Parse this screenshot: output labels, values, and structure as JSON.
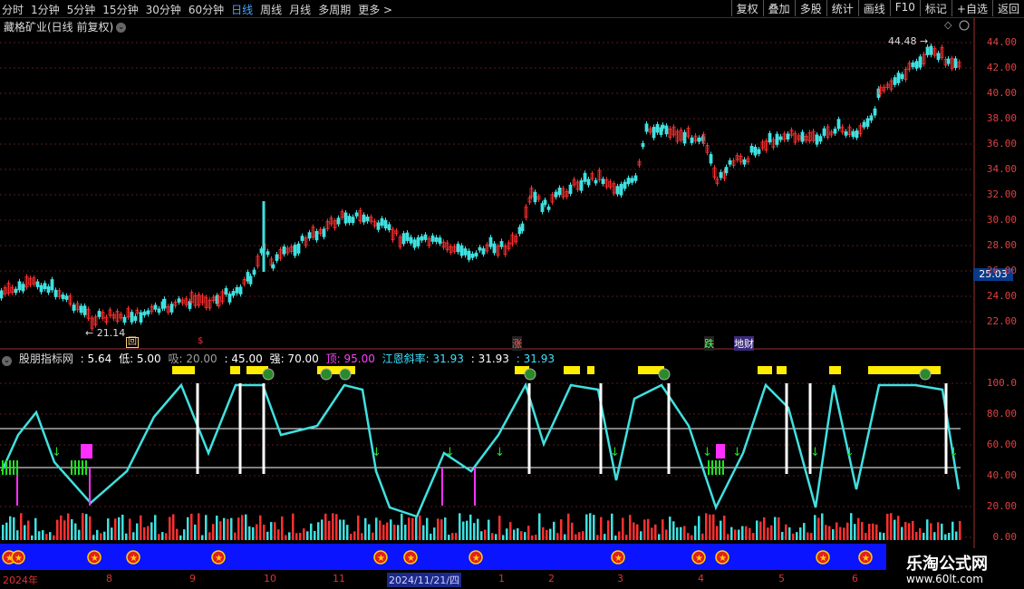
{
  "toolbar": {
    "periods": [
      "分时",
      "1分钟",
      "5分钟",
      "15分钟",
      "30分钟",
      "60分钟",
      "日线",
      "周线",
      "月线",
      "多周期",
      "更多 >"
    ],
    "active_period": "日线",
    "actions": [
      "复权",
      "叠加",
      "多股",
      "统计",
      "画线",
      "F10",
      "标记",
      "+自选",
      "返回"
    ]
  },
  "stock": {
    "title": "藏格矿业(日线 前复权)"
  },
  "price_axis": [
    "44.00",
    "42.00",
    "40.00",
    "38.00",
    "36.00",
    "34.00",
    "32.00",
    "30.00",
    "28.00",
    "26.00",
    "24.00",
    "22.00"
  ],
  "current_price": "25.03",
  "annotations": {
    "high": "44.48",
    "low": "21.14"
  },
  "markers": [
    "回",
    "$",
    "涨",
    "跌",
    "地财"
  ],
  "indicator": {
    "name": "股朋指标网",
    "v1": ": 5.64",
    "low_label": "低: 5.00",
    "xi_label": "吸: 20.00",
    "v2": ": 45.00",
    "qiang_label": "强: 70.00",
    "ding_label": "顶: 95.00",
    "slope_label": "江恩斜率: 31.93",
    "v3": ": 31.93",
    "v4": ": 31.93"
  },
  "indicator_axis": [
    "100.0",
    "80.00",
    "60.00",
    "40.00",
    "20.00",
    "0.00"
  ],
  "date_axis": [
    "2024年",
    "8",
    "9",
    "10",
    "11",
    "2024/11/21/四",
    "1",
    "2",
    "3",
    "4",
    "5",
    "6"
  ],
  "watermark": {
    "line1": "乐淘公式网",
    "line2": "www.60lt.com"
  },
  "colors": {
    "up": "#ff3030",
    "down": "#40e0e0",
    "accent": "#4aa3ff",
    "yellow": "#ffee00",
    "magenta": "#ff30ff",
    "band": "#0a14ff"
  }
}
